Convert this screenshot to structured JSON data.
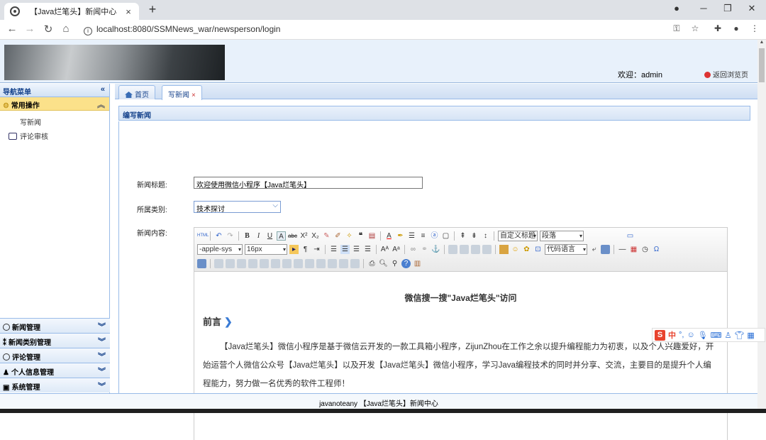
{
  "browser": {
    "tab_title": "【Java烂笔头】新闻中心",
    "tab_close": "×",
    "new_tab": "+",
    "url": "localhost:8080/SSMNews_war/newsperson/login"
  },
  "header": {
    "welcome": "欢迎：admin",
    "back_link": "返回浏览页"
  },
  "sidebar": {
    "title": "导航菜单",
    "active_group": "常用操作",
    "items": [
      {
        "label": "写新闻"
      },
      {
        "label": "评论审核"
      }
    ],
    "groups": [
      {
        "label": "新闻管理"
      },
      {
        "label": "新闻类别管理"
      },
      {
        "label": "评论管理"
      },
      {
        "label": "个人信息管理"
      },
      {
        "label": "系统管理"
      }
    ]
  },
  "main": {
    "tabs": [
      {
        "label": "首页"
      },
      {
        "label": "写新闻",
        "close": "×"
      }
    ],
    "panel_title": "编写新闻",
    "form": {
      "title_label": "新闻标题:",
      "title_value": "欢迎使用微信小程序【Java烂笔头】",
      "category_label": "所属类别:",
      "category_value": "技术探讨",
      "content_label": "新闻内容:"
    },
    "editor": {
      "toolbar": {
        "font_family": "-apple-sys",
        "font_size": "16px",
        "custom_heading": "自定义标题",
        "paragraph": "段落",
        "code_lang": "代码语言"
      },
      "content_title": "微信搜一搜\"Java烂笔头\"访问",
      "content_heading": "前言",
      "content_paragraph": "【Java烂笔头】微信小程序是基于微信云开发的一款工具箱小程序，ZijunZhou在工作之余以提升编程能力为初衷，以及个人兴趣爱好，开始运营个人微信公众号【Java烂笔头】以及开发【Java烂笔头】微信小程序，学习Java编程技术的同时并分享、交流，主要目的是提升个人编程能力，努力做一名优秀的软件工程师！"
    }
  },
  "footer": {
    "text": "javanoteany 【Java烂笔头】新闻中心"
  },
  "ime": {
    "logo": "S",
    "lang": "中",
    "punct": "°,"
  }
}
